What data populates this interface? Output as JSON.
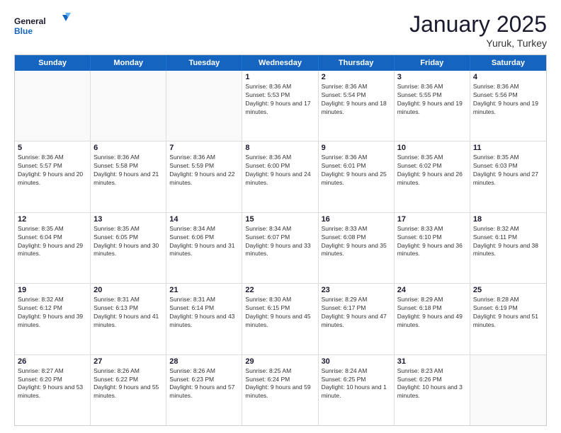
{
  "logo": {
    "text_general": "General",
    "text_blue": "Blue"
  },
  "title": "January 2025",
  "subtitle": "Yuruk, Turkey",
  "header_days": [
    "Sunday",
    "Monday",
    "Tuesday",
    "Wednesday",
    "Thursday",
    "Friday",
    "Saturday"
  ],
  "weeks": [
    [
      {
        "day": "",
        "sunrise": "",
        "sunset": "",
        "daylight": "",
        "empty": true
      },
      {
        "day": "",
        "sunrise": "",
        "sunset": "",
        "daylight": "",
        "empty": true
      },
      {
        "day": "",
        "sunrise": "",
        "sunset": "",
        "daylight": "",
        "empty": true
      },
      {
        "day": "1",
        "sunrise": "Sunrise: 8:36 AM",
        "sunset": "Sunset: 5:53 PM",
        "daylight": "Daylight: 9 hours and 17 minutes.",
        "empty": false
      },
      {
        "day": "2",
        "sunrise": "Sunrise: 8:36 AM",
        "sunset": "Sunset: 5:54 PM",
        "daylight": "Daylight: 9 hours and 18 minutes.",
        "empty": false
      },
      {
        "day": "3",
        "sunrise": "Sunrise: 8:36 AM",
        "sunset": "Sunset: 5:55 PM",
        "daylight": "Daylight: 9 hours and 19 minutes.",
        "empty": false
      },
      {
        "day": "4",
        "sunrise": "Sunrise: 8:36 AM",
        "sunset": "Sunset: 5:56 PM",
        "daylight": "Daylight: 9 hours and 19 minutes.",
        "empty": false
      }
    ],
    [
      {
        "day": "5",
        "sunrise": "Sunrise: 8:36 AM",
        "sunset": "Sunset: 5:57 PM",
        "daylight": "Daylight: 9 hours and 20 minutes.",
        "empty": false
      },
      {
        "day": "6",
        "sunrise": "Sunrise: 8:36 AM",
        "sunset": "Sunset: 5:58 PM",
        "daylight": "Daylight: 9 hours and 21 minutes.",
        "empty": false
      },
      {
        "day": "7",
        "sunrise": "Sunrise: 8:36 AM",
        "sunset": "Sunset: 5:59 PM",
        "daylight": "Daylight: 9 hours and 22 minutes.",
        "empty": false
      },
      {
        "day": "8",
        "sunrise": "Sunrise: 8:36 AM",
        "sunset": "Sunset: 6:00 PM",
        "daylight": "Daylight: 9 hours and 24 minutes.",
        "empty": false
      },
      {
        "day": "9",
        "sunrise": "Sunrise: 8:36 AM",
        "sunset": "Sunset: 6:01 PM",
        "daylight": "Daylight: 9 hours and 25 minutes.",
        "empty": false
      },
      {
        "day": "10",
        "sunrise": "Sunrise: 8:35 AM",
        "sunset": "Sunset: 6:02 PM",
        "daylight": "Daylight: 9 hours and 26 minutes.",
        "empty": false
      },
      {
        "day": "11",
        "sunrise": "Sunrise: 8:35 AM",
        "sunset": "Sunset: 6:03 PM",
        "daylight": "Daylight: 9 hours and 27 minutes.",
        "empty": false
      }
    ],
    [
      {
        "day": "12",
        "sunrise": "Sunrise: 8:35 AM",
        "sunset": "Sunset: 6:04 PM",
        "daylight": "Daylight: 9 hours and 29 minutes.",
        "empty": false
      },
      {
        "day": "13",
        "sunrise": "Sunrise: 8:35 AM",
        "sunset": "Sunset: 6:05 PM",
        "daylight": "Daylight: 9 hours and 30 minutes.",
        "empty": false
      },
      {
        "day": "14",
        "sunrise": "Sunrise: 8:34 AM",
        "sunset": "Sunset: 6:06 PM",
        "daylight": "Daylight: 9 hours and 31 minutes.",
        "empty": false
      },
      {
        "day": "15",
        "sunrise": "Sunrise: 8:34 AM",
        "sunset": "Sunset: 6:07 PM",
        "daylight": "Daylight: 9 hours and 33 minutes.",
        "empty": false
      },
      {
        "day": "16",
        "sunrise": "Sunrise: 8:33 AM",
        "sunset": "Sunset: 6:08 PM",
        "daylight": "Daylight: 9 hours and 35 minutes.",
        "empty": false
      },
      {
        "day": "17",
        "sunrise": "Sunrise: 8:33 AM",
        "sunset": "Sunset: 6:10 PM",
        "daylight": "Daylight: 9 hours and 36 minutes.",
        "empty": false
      },
      {
        "day": "18",
        "sunrise": "Sunrise: 8:32 AM",
        "sunset": "Sunset: 6:11 PM",
        "daylight": "Daylight: 9 hours and 38 minutes.",
        "empty": false
      }
    ],
    [
      {
        "day": "19",
        "sunrise": "Sunrise: 8:32 AM",
        "sunset": "Sunset: 6:12 PM",
        "daylight": "Daylight: 9 hours and 39 minutes.",
        "empty": false
      },
      {
        "day": "20",
        "sunrise": "Sunrise: 8:31 AM",
        "sunset": "Sunset: 6:13 PM",
        "daylight": "Daylight: 9 hours and 41 minutes.",
        "empty": false
      },
      {
        "day": "21",
        "sunrise": "Sunrise: 8:31 AM",
        "sunset": "Sunset: 6:14 PM",
        "daylight": "Daylight: 9 hours and 43 minutes.",
        "empty": false
      },
      {
        "day": "22",
        "sunrise": "Sunrise: 8:30 AM",
        "sunset": "Sunset: 6:15 PM",
        "daylight": "Daylight: 9 hours and 45 minutes.",
        "empty": false
      },
      {
        "day": "23",
        "sunrise": "Sunrise: 8:29 AM",
        "sunset": "Sunset: 6:17 PM",
        "daylight": "Daylight: 9 hours and 47 minutes.",
        "empty": false
      },
      {
        "day": "24",
        "sunrise": "Sunrise: 8:29 AM",
        "sunset": "Sunset: 6:18 PM",
        "daylight": "Daylight: 9 hours and 49 minutes.",
        "empty": false
      },
      {
        "day": "25",
        "sunrise": "Sunrise: 8:28 AM",
        "sunset": "Sunset: 6:19 PM",
        "daylight": "Daylight: 9 hours and 51 minutes.",
        "empty": false
      }
    ],
    [
      {
        "day": "26",
        "sunrise": "Sunrise: 8:27 AM",
        "sunset": "Sunset: 6:20 PM",
        "daylight": "Daylight: 9 hours and 53 minutes.",
        "empty": false
      },
      {
        "day": "27",
        "sunrise": "Sunrise: 8:26 AM",
        "sunset": "Sunset: 6:22 PM",
        "daylight": "Daylight: 9 hours and 55 minutes.",
        "empty": false
      },
      {
        "day": "28",
        "sunrise": "Sunrise: 8:26 AM",
        "sunset": "Sunset: 6:23 PM",
        "daylight": "Daylight: 9 hours and 57 minutes.",
        "empty": false
      },
      {
        "day": "29",
        "sunrise": "Sunrise: 8:25 AM",
        "sunset": "Sunset: 6:24 PM",
        "daylight": "Daylight: 9 hours and 59 minutes.",
        "empty": false
      },
      {
        "day": "30",
        "sunrise": "Sunrise: 8:24 AM",
        "sunset": "Sunset: 6:25 PM",
        "daylight": "Daylight: 10 hours and 1 minute.",
        "empty": false
      },
      {
        "day": "31",
        "sunrise": "Sunrise: 8:23 AM",
        "sunset": "Sunset: 6:26 PM",
        "daylight": "Daylight: 10 hours and 3 minutes.",
        "empty": false
      },
      {
        "day": "",
        "sunrise": "",
        "sunset": "",
        "daylight": "",
        "empty": true
      }
    ]
  ]
}
